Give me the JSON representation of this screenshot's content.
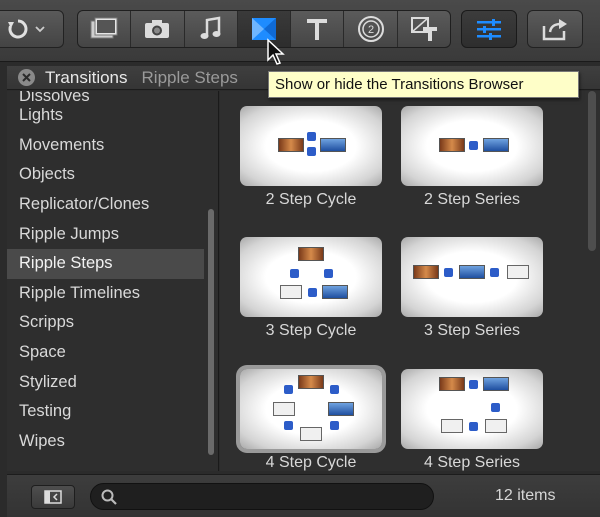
{
  "toolbar": {
    "tools": [
      {
        "name": "film-icon"
      },
      {
        "name": "camera-icon"
      },
      {
        "name": "music-note-icon"
      },
      {
        "name": "transitions-icon",
        "active": true
      },
      {
        "name": "title-t-icon"
      },
      {
        "name": "generator-icon"
      },
      {
        "name": "themes-icon"
      }
    ],
    "accent": "#1e8cff"
  },
  "browser": {
    "title": "Transitions",
    "subtitle": "Ripple Steps"
  },
  "tooltip": {
    "text": "Show or hide the Transitions Browser"
  },
  "sidebar": {
    "items": [
      {
        "label": "Dissolves"
      },
      {
        "label": "Lights"
      },
      {
        "label": "Movements"
      },
      {
        "label": "Objects"
      },
      {
        "label": "Replicator/Clones"
      },
      {
        "label": "Ripple Jumps"
      },
      {
        "label": "Ripple Steps",
        "selected": true
      },
      {
        "label": "Ripple Timelines"
      },
      {
        "label": "Scripps"
      },
      {
        "label": "Space"
      },
      {
        "label": "Stylized"
      },
      {
        "label": "Testing"
      },
      {
        "label": "Wipes"
      }
    ]
  },
  "grid": {
    "items": [
      {
        "label": "2 Step Cycle"
      },
      {
        "label": "2 Step Series"
      },
      {
        "label": "3 Step Cycle"
      },
      {
        "label": "3 Step Series"
      },
      {
        "label": "4 Step Cycle",
        "selected": true
      },
      {
        "label": "4 Step Series"
      }
    ]
  },
  "footer": {
    "search_value": "",
    "item_count": "12 items"
  }
}
